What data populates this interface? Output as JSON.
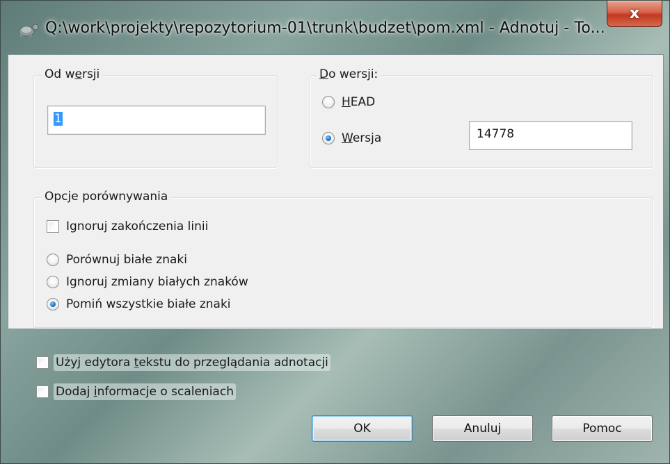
{
  "window": {
    "title": "Q:\\work\\projekty\\repozytorium-01\\trunk\\budzet\\pom.xml - Adnotuj - To...",
    "close_label": "x"
  },
  "from_revision": {
    "group_label_pre": "Od w",
    "group_label_key": "e",
    "group_label_post": "rsji",
    "value": "1"
  },
  "to_revision": {
    "group_label_key": "D",
    "group_label_post": "o wersji:",
    "head_key": "H",
    "head_post": "EAD",
    "head_checked": false,
    "revision_key": "W",
    "revision_post": "ersja",
    "revision_checked": true,
    "revision_value": "14778"
  },
  "compare_options": {
    "group_label": "Opcje porównywania",
    "ignore_eol_label": "Ignoruj zakończenia linii",
    "ignore_eol_checked": false,
    "whitespace_options": [
      {
        "label": "Porównuj białe znaki",
        "checked": false
      },
      {
        "label": "Ignoruj zmiany białych znaków",
        "checked": false
      },
      {
        "label": "Pomiń wszystkie białe znaki",
        "checked": true
      }
    ]
  },
  "bottom_options": {
    "text_editor_pre": "Użyj edytora ",
    "text_editor_key": "t",
    "text_editor_post": "ekstu do przeglądania adnotacji",
    "text_editor_checked": false,
    "merge_info_pre": "Dodaj ",
    "merge_info_key": "i",
    "merge_info_post": "nformacje o scaleniach",
    "merge_info_checked": false
  },
  "buttons": {
    "ok": "OK",
    "cancel": "Anuluj",
    "help": "Pomoc"
  },
  "colors": {
    "selection": "#3399ff",
    "close_button": "#c3391f",
    "radio_dot": "#1d72c9"
  }
}
